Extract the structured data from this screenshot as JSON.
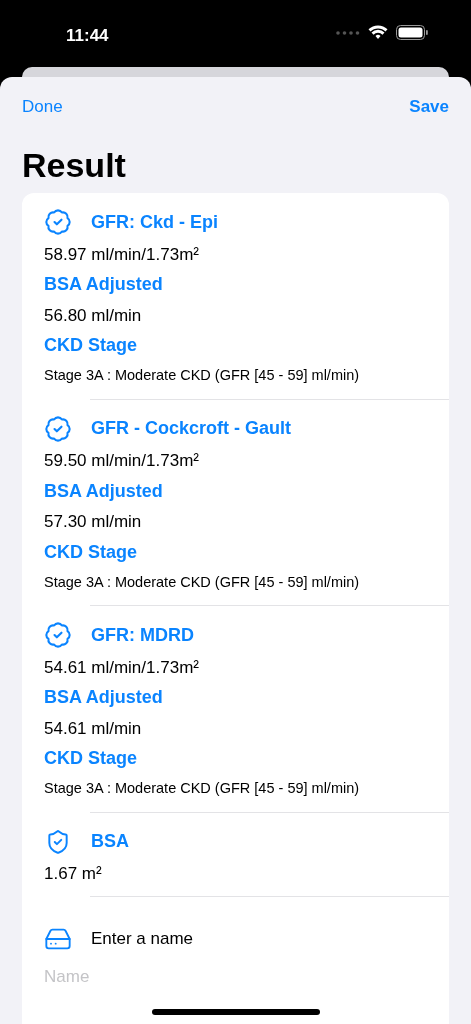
{
  "status_bar": {
    "time": "11:44"
  },
  "nav": {
    "left_button": "Done",
    "right_button": "Save"
  },
  "title": "Result",
  "sections": [
    {
      "kind": "gfr",
      "title": "GFR: Ckd - Epi",
      "value": "58.97 ml/min/1.73m²",
      "fields": [
        {
          "kind": "regular",
          "label": "BSA Adjusted",
          "value": "56.80 ml/min"
        },
        {
          "kind": "small",
          "label": "CKD Stage",
          "value": "Stage 3A : Moderate CKD (GFR [45 - 59] ml/min)"
        }
      ]
    },
    {
      "kind": "gfr",
      "title": "GFR - Cockcroft - Gault",
      "value": "59.50 ml/min/1.73m²",
      "fields": [
        {
          "kind": "regular",
          "label": "BSA Adjusted",
          "value": "57.30 ml/min"
        },
        {
          "kind": "small",
          "label": "CKD Stage",
          "value": "Stage 3A : Moderate CKD (GFR [45 - 59] ml/min)"
        }
      ]
    },
    {
      "kind": "gfr",
      "title": "GFR: MDRD",
      "value": "54.61 ml/min/1.73m²",
      "fields": [
        {
          "kind": "regular",
          "label": "BSA Adjusted",
          "value": "54.61 ml/min"
        },
        {
          "kind": "small",
          "label": "CKD Stage",
          "value": "Stage 3A : Moderate CKD (GFR [45 - 59] ml/min)"
        }
      ]
    },
    {
      "kind": "bsa",
      "title": "BSA",
      "value": "1.67 m²"
    }
  ],
  "name_field": {
    "label": "Enter a name",
    "placeholder": "Name"
  }
}
